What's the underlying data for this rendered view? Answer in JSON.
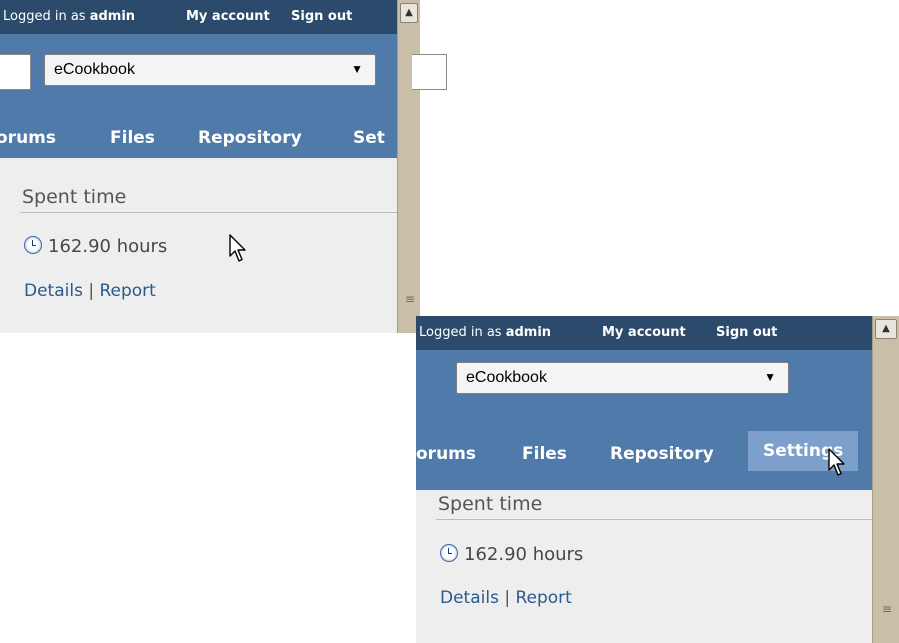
{
  "topbar": {
    "logged_prefix": "Logged in as ",
    "user": "admin",
    "my_account": "My account",
    "sign_out": "Sign out"
  },
  "project_selector": {
    "value": "eCookbook"
  },
  "tabs": {
    "forums": "orums",
    "files": "Files",
    "repository": "Repository",
    "settings_cut": "Set",
    "settings": "Settings"
  },
  "spent_time": {
    "title": "Spent time",
    "hours": "162.90 hours",
    "details": "Details",
    "separator": "|",
    "report": "Report"
  },
  "icons": {
    "clock": "clock-icon",
    "cursor": "mouse-pointer-icon"
  },
  "colors": {
    "topbar": "#2c4b6c",
    "header": "#507aaa",
    "selected_tab": "#7c9fcc",
    "link": "#2a5a8e",
    "content_bg": "#eeeeee"
  }
}
